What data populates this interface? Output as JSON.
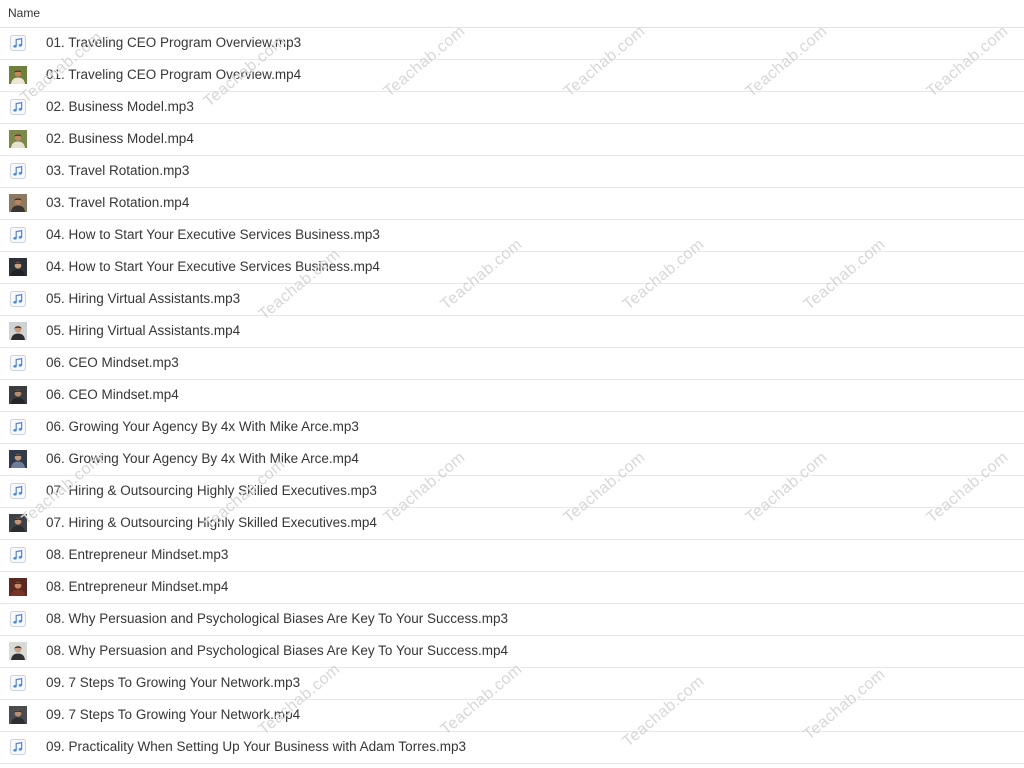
{
  "header": {
    "name_label": "Name"
  },
  "watermark": {
    "text": "Teachab.com"
  },
  "colors": {
    "note": "#4f86d6",
    "text": "#363636",
    "divider": "#e6e6e6"
  },
  "files": [
    {
      "name": "01. Traveling CEO Program Overview.mp3",
      "icon": "music-note-icon"
    },
    {
      "name": "01. Traveling CEO Program Overview.mp4",
      "icon": "video-thumbnail",
      "thumb": {
        "bg": "#6f7f3e",
        "skin": "#c7855a",
        "shirt": "#efe5d4",
        "hair": "#3a2a20"
      }
    },
    {
      "name": "02. Business Model.mp3",
      "icon": "music-note-icon"
    },
    {
      "name": "02. Business Model.mp4",
      "icon": "video-thumbnail",
      "thumb": {
        "bg": "#7b8a4a",
        "skin": "#c28a64",
        "shirt": "#e8e0d0",
        "hair": "#3a2a20"
      }
    },
    {
      "name": "03. Travel Rotation.mp3",
      "icon": "music-note-icon"
    },
    {
      "name": "03. Travel Rotation.mp4",
      "icon": "video-thumbnail",
      "thumb": {
        "bg": "#8a7a62",
        "skin": "#b8835f",
        "shirt": "#3a3530",
        "hair": "#2a201a"
      }
    },
    {
      "name": "04. How to Start Your Executive Services Business.mp3",
      "icon": "music-note-icon"
    },
    {
      "name": "04. How to Start Your Executive Services Business.mp4",
      "icon": "video-thumbnail",
      "thumb": {
        "bg": "#2e3136",
        "skin": "#c9a084",
        "shirt": "#1f2226",
        "hair": "#1a1a1a"
      }
    },
    {
      "name": "05. Hiring Virtual Assistants.mp3",
      "icon": "music-note-icon"
    },
    {
      "name": "05. Hiring Virtual Assistants.mp4",
      "icon": "video-thumbnail",
      "thumb": {
        "bg": "#cfd2d4",
        "skin": "#c59a7c",
        "shirt": "#2b2d31",
        "hair": "#2a221e"
      }
    },
    {
      "name": "06. CEO Mindset.mp3",
      "icon": "music-note-icon"
    },
    {
      "name": "06. CEO Mindset.mp4",
      "icon": "video-thumbnail",
      "thumb": {
        "bg": "#3a3c40",
        "skin": "#b58c70",
        "shirt": "#25272b",
        "hair": "#1c1c1c"
      }
    },
    {
      "name": "06. Growing Your Agency By 4x With Mike Arce.mp3",
      "icon": "music-note-icon"
    },
    {
      "name": "06. Growing Your Agency By 4x With Mike Arce.mp4",
      "icon": "video-thumbnail",
      "thumb": {
        "bg": "#2f3a4a",
        "skin": "#c09a80",
        "shirt": "#6d7f98",
        "hair": "#1e1e22"
      }
    },
    {
      "name": "07. Hiring & Outsourcing Highly Skilled Executives.mp3",
      "icon": "music-note-icon"
    },
    {
      "name": "07. Hiring & Outsourcing Highly Skilled Executives.mp4",
      "icon": "video-thumbnail",
      "thumb": {
        "bg": "#3d4046",
        "skin": "#c29478",
        "shirt": "#2a2c30",
        "hair": "#1c1c1c"
      }
    },
    {
      "name": "08. Entrepreneur Mindset.mp3",
      "icon": "music-note-icon"
    },
    {
      "name": "08. Entrepreneur Mindset.mp4",
      "icon": "video-thumbnail",
      "thumb": {
        "bg": "#5a2a22",
        "skin": "#c88a66",
        "shirt": "#7a3328",
        "hair": "#2a1a14"
      }
    },
    {
      "name": "08. Why Persuasion and Psychological Biases Are Key To Your Success.mp3",
      "icon": "music-note-icon"
    },
    {
      "name": "08. Why Persuasion and Psychological Biases Are Key To Your Success.mp4",
      "icon": "video-thumbnail",
      "thumb": {
        "bg": "#d8dad6",
        "skin": "#c9a08a",
        "shirt": "#2e3034",
        "hair": "#2a221e"
      }
    },
    {
      "name": "09. 7 Steps To Growing Your Network.mp3",
      "icon": "music-note-icon"
    },
    {
      "name": "09. 7 Steps To Growing Your Network.mp4",
      "icon": "video-thumbnail",
      "thumb": {
        "bg": "#4a4c50",
        "skin": "#b98e74",
        "shirt": "#2c2e32",
        "hair": "#1e1e1e"
      }
    },
    {
      "name": "09. Practicality When Setting Up Your Business with Adam Torres.mp3",
      "icon": "music-note-icon"
    }
  ]
}
